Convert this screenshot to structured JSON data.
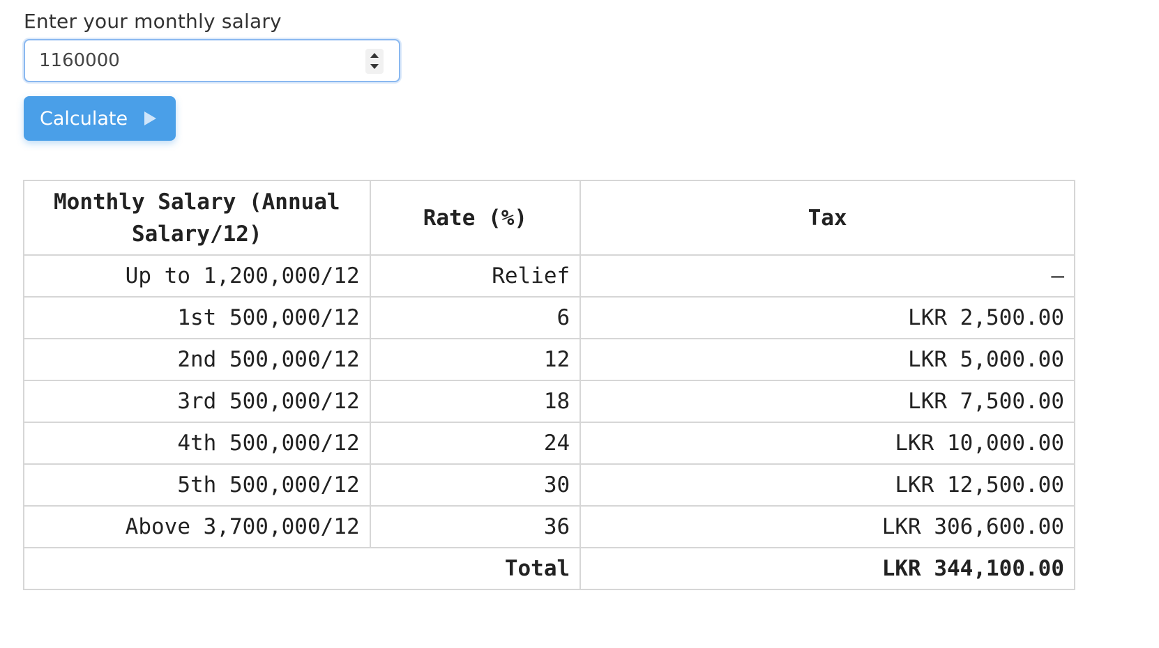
{
  "form": {
    "label": "Enter your monthly salary",
    "salary_value": "1160000",
    "button_label": "Calculate"
  },
  "table": {
    "headers": {
      "salary": "Monthly Salary (Annual Salary/12)",
      "rate": "Rate (%)",
      "tax": "Tax"
    },
    "rows": [
      {
        "salary": "Up to 1,200,000/12",
        "rate": "Relief",
        "tax": "–"
      },
      {
        "salary": "1st 500,000/12",
        "rate": "6",
        "tax": "LKR 2,500.00"
      },
      {
        "salary": "2nd 500,000/12",
        "rate": "12",
        "tax": "LKR 5,000.00"
      },
      {
        "salary": "3rd 500,000/12",
        "rate": "18",
        "tax": "LKR 7,500.00"
      },
      {
        "salary": "4th 500,000/12",
        "rate": "24",
        "tax": "LKR 10,000.00"
      },
      {
        "salary": "5th 500,000/12",
        "rate": "30",
        "tax": "LKR 12,500.00"
      },
      {
        "salary": "Above 3,700,000/12",
        "rate": "36",
        "tax": "LKR 306,600.00"
      }
    ],
    "total": {
      "label": "Total",
      "tax": "LKR 344,100.00"
    }
  },
  "icons": {
    "button_icon": "play-icon",
    "stepper_icons": [
      "chevron-up-icon",
      "chevron-down-icon"
    ]
  },
  "colors": {
    "button_background": "#4a9fe8",
    "input_focus_border": "#8ab8f0",
    "table_border": "#d6d6d6"
  }
}
